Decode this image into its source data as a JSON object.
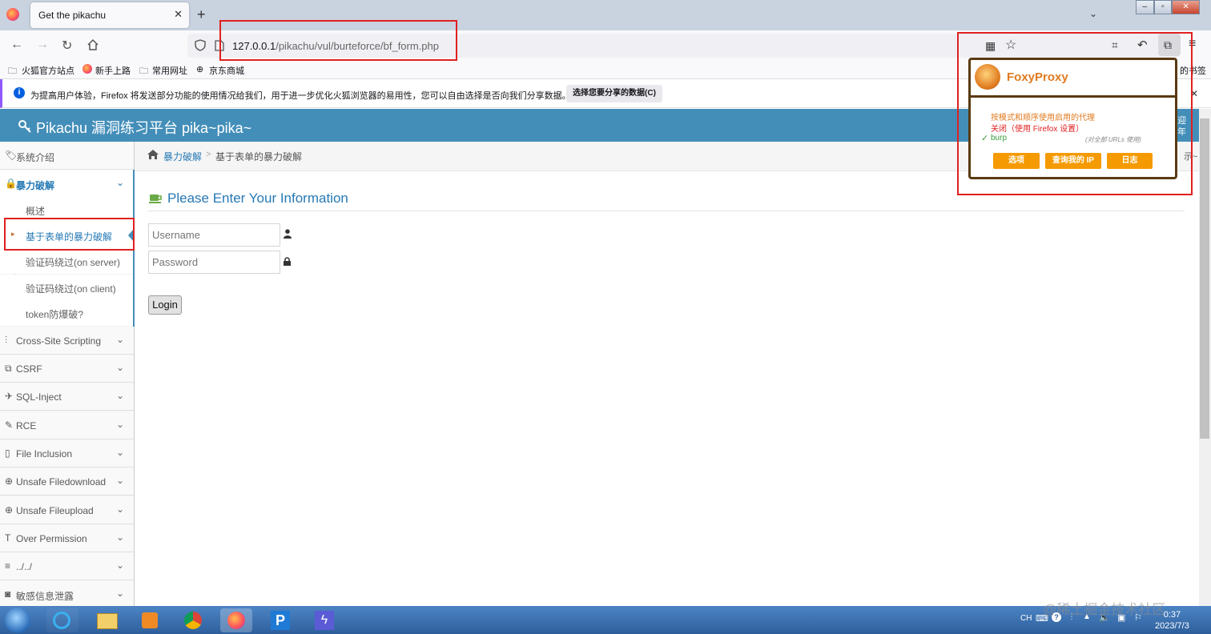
{
  "browser": {
    "tab_title": "Get the pikachu",
    "tab_close": "✕",
    "new_tab": "+",
    "url_host": "127.0.0.1",
    "url_path": "/pikachu/vul/burteforce/bf_form.php",
    "bookmarks": [
      "火狐官方站点",
      "新手上路",
      "常用网址",
      "京东商城"
    ],
    "bookmarks_right": "的书签",
    "notification_text": "为提高用户体验，Firefox 将发送部分功能的使用情况给我们，用于进一步优化火狐浏览器的易用性，您可以自由选择是否向我们分享数据。",
    "notification_button": "选择您要分享的数据(C)"
  },
  "app": {
    "title": "Pikachu 漏洞练习平台 pika~pika~",
    "header_right_1": "迎",
    "header_right_2": "年",
    "crumb_right": "示~"
  },
  "sidebar": {
    "items": [
      {
        "label": "系统介绍"
      },
      {
        "label": "暴力破解"
      },
      {
        "label": "Cross-Site Scripting"
      },
      {
        "label": "CSRF"
      },
      {
        "label": "SQL-Inject"
      },
      {
        "label": "RCE"
      },
      {
        "label": "File Inclusion"
      },
      {
        "label": "Unsafe Filedownload"
      },
      {
        "label": "Unsafe Fileupload"
      },
      {
        "label": "Over Permission"
      },
      {
        "label": "../../"
      },
      {
        "label": "敏感信息泄露"
      }
    ],
    "sub_items": [
      {
        "label": "概述"
      },
      {
        "label": "基于表单的暴力破解"
      },
      {
        "label": "验证码绕过(on server)"
      },
      {
        "label": "验证码绕过(on client)"
      },
      {
        "label": "token防爆破?"
      }
    ]
  },
  "breadcrumb": {
    "parent": "暴力破解",
    "sep": ">",
    "current": "基于表单的暴力破解"
  },
  "form": {
    "heading": "Please Enter Your Information",
    "username_placeholder": "Username",
    "password_placeholder": "Password",
    "login_label": "Login"
  },
  "foxy": {
    "title": "FoxyProxy",
    "mode_line": "按模式和顺序使用启用的代理",
    "off_line": "关闭（使用 Firefox 设置）",
    "check": "✓",
    "proxy_name": "burp",
    "proxy_note": "(对全部 URLs 使用)",
    "btn_options": "选项",
    "btn_myip": "查询我的 IP",
    "btn_log": "日志"
  },
  "taskbar": {
    "lang": "CH",
    "time": "0:37",
    "date": "2023/7/3",
    "watermark": "@稀土掘金技术社区"
  },
  "colors": {
    "accent": "#438eb9",
    "link": "#2679b5",
    "annotation": "#e02020",
    "foxy_orange": "#f59a00"
  }
}
